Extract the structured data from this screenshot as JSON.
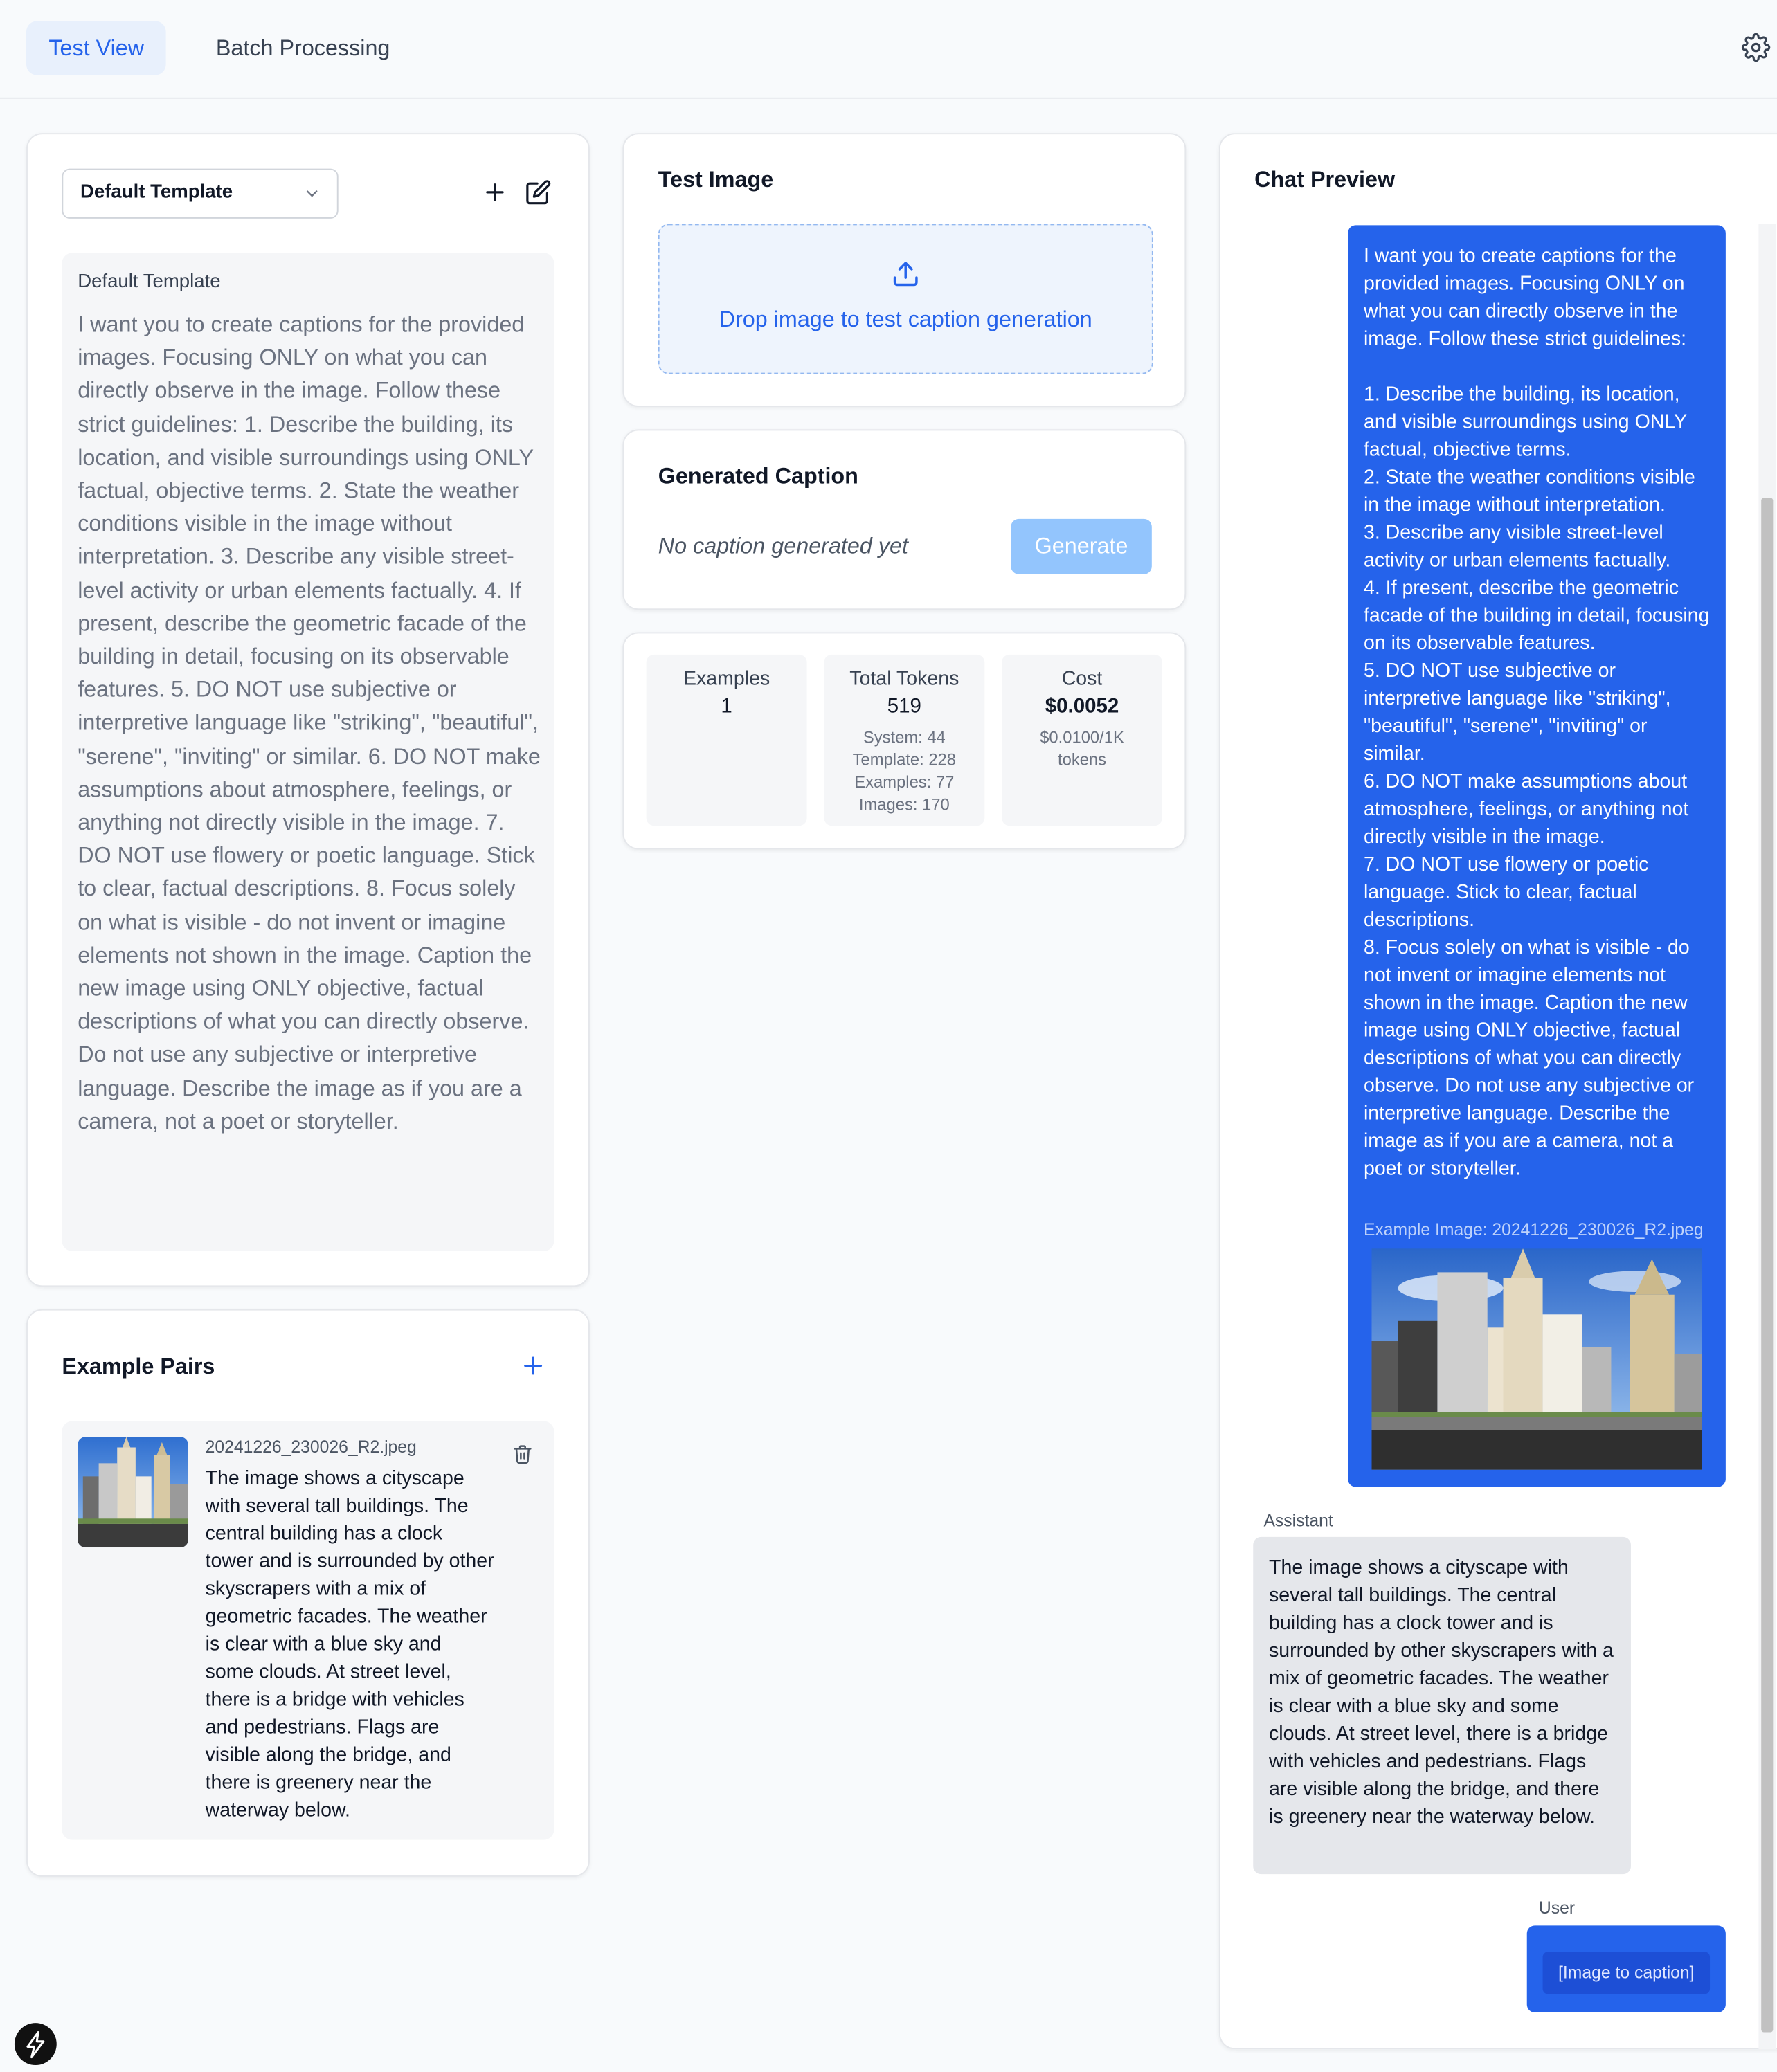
{
  "header": {
    "tabs": [
      {
        "label": "Test View",
        "active": true
      },
      {
        "label": "Batch Processing",
        "active": false
      }
    ],
    "settings_icon": "gear-icon"
  },
  "template_panel": {
    "selected_template": "Default Template",
    "template_name": "Default Template",
    "template_text": "I want you to create captions for the provided images. Focusing ONLY on what you can directly observe in the image. Follow these strict guidelines: 1. Describe the building, its location, and visible surroundings using ONLY factual, objective terms. 2. State the weather conditions visible in the image without interpretation. 3. Describe any visible street-level activity or urban elements factually. 4. If present, describe the geometric facade of the building in detail, focusing on its observable features. 5. DO NOT use subjective or interpretive language like \"striking\", \"beautiful\", \"serene\", \"inviting\" or similar. 6. DO NOT make assumptions about atmosphere, feelings, or anything not directly visible in the image. 7. DO NOT use flowery or poetic language. Stick to clear, factual descriptions. 8. Focus solely on what is visible - do not invent or imagine elements not shown in the image. Caption the new image using ONLY objective, factual descriptions of what you can directly observe. Do not use any subjective or interpretive language. Describe the image as if you are a camera, not a poet or storyteller."
  },
  "example_pairs": {
    "title": "Example Pairs",
    "items": [
      {
        "filename": "20241226_230026_R2.jpeg",
        "caption": "The image shows a cityscape with several tall buildings. The central building has a clock tower and is surrounded by other skyscrapers with a mix of geometric facades. The weather is clear with a blue sky and some clouds. At street level, there is a bridge with vehicles and pedestrians. Flags are visible along the bridge, and there is greenery near the waterway below."
      }
    ]
  },
  "test_image": {
    "title": "Test Image",
    "drop_label": "Drop image to test caption generation"
  },
  "generated_caption": {
    "title": "Generated Caption",
    "placeholder": "No caption generated yet",
    "generate_label": "Generate"
  },
  "stats": {
    "examples": {
      "label": "Examples",
      "value": "1"
    },
    "tokens": {
      "label": "Total Tokens",
      "value": "519",
      "system": "System: 44",
      "template": "Template: 228",
      "examples": "Examples: 77",
      "images": "Images: 170"
    },
    "cost": {
      "label": "Cost",
      "value": "$0.0052",
      "rate_line1": "$0.0100/1K",
      "rate_line2": "tokens"
    }
  },
  "chat_preview": {
    "title": "Chat Preview",
    "user_message": "I want you to create captions for the provided images. Focusing ONLY on what you can directly observe in the image. Follow these strict guidelines:\n\n1. Describe the building, its location, and visible surroundings using ONLY factual, objective terms.\n2. State the weather conditions visible in the image without interpretation.\n3. Describe any visible street-level activity or urban elements factually.\n4. If present, describe the geometric facade of the building in detail, focusing on its observable features.\n5. DO NOT use subjective or interpretive language like \"striking\", \"beautiful\", \"serene\", \"inviting\" or similar.\n6. DO NOT make assumptions about atmosphere, feelings, or anything not directly visible in the image.\n7. DO NOT use flowery or poetic language. Stick to clear, factual descriptions.\n8. Focus solely on what is visible - do not invent or imagine elements not shown in the image. Caption the new image using ONLY objective, factual descriptions of what you can directly observe. Do not use any subjective or interpretive language. Describe the image as if you are a camera, not a poet or storyteller.",
    "example_image_label": "Example Image: 20241226_230026_R2.jpeg",
    "assistant_label": "Assistant",
    "assistant_message": "The image shows a cityscape with several tall buildings. The central building has a clock tower and is surrounded by other skyscrapers with a mix of geometric facades. The weather is clear with a blue sky and some clouds. At street level, there is a bridge with vehicles and pedestrians. Flags are visible along the bridge, and there is greenery near the waterway below.",
    "user_label": "User",
    "user_image_placeholder": "[Image to caption]"
  },
  "colors": {
    "accent": "#2563eb",
    "accent_light": "#93c5fd",
    "panel_bg": "#f5f6f8",
    "page_bg": "#f8fafc"
  }
}
